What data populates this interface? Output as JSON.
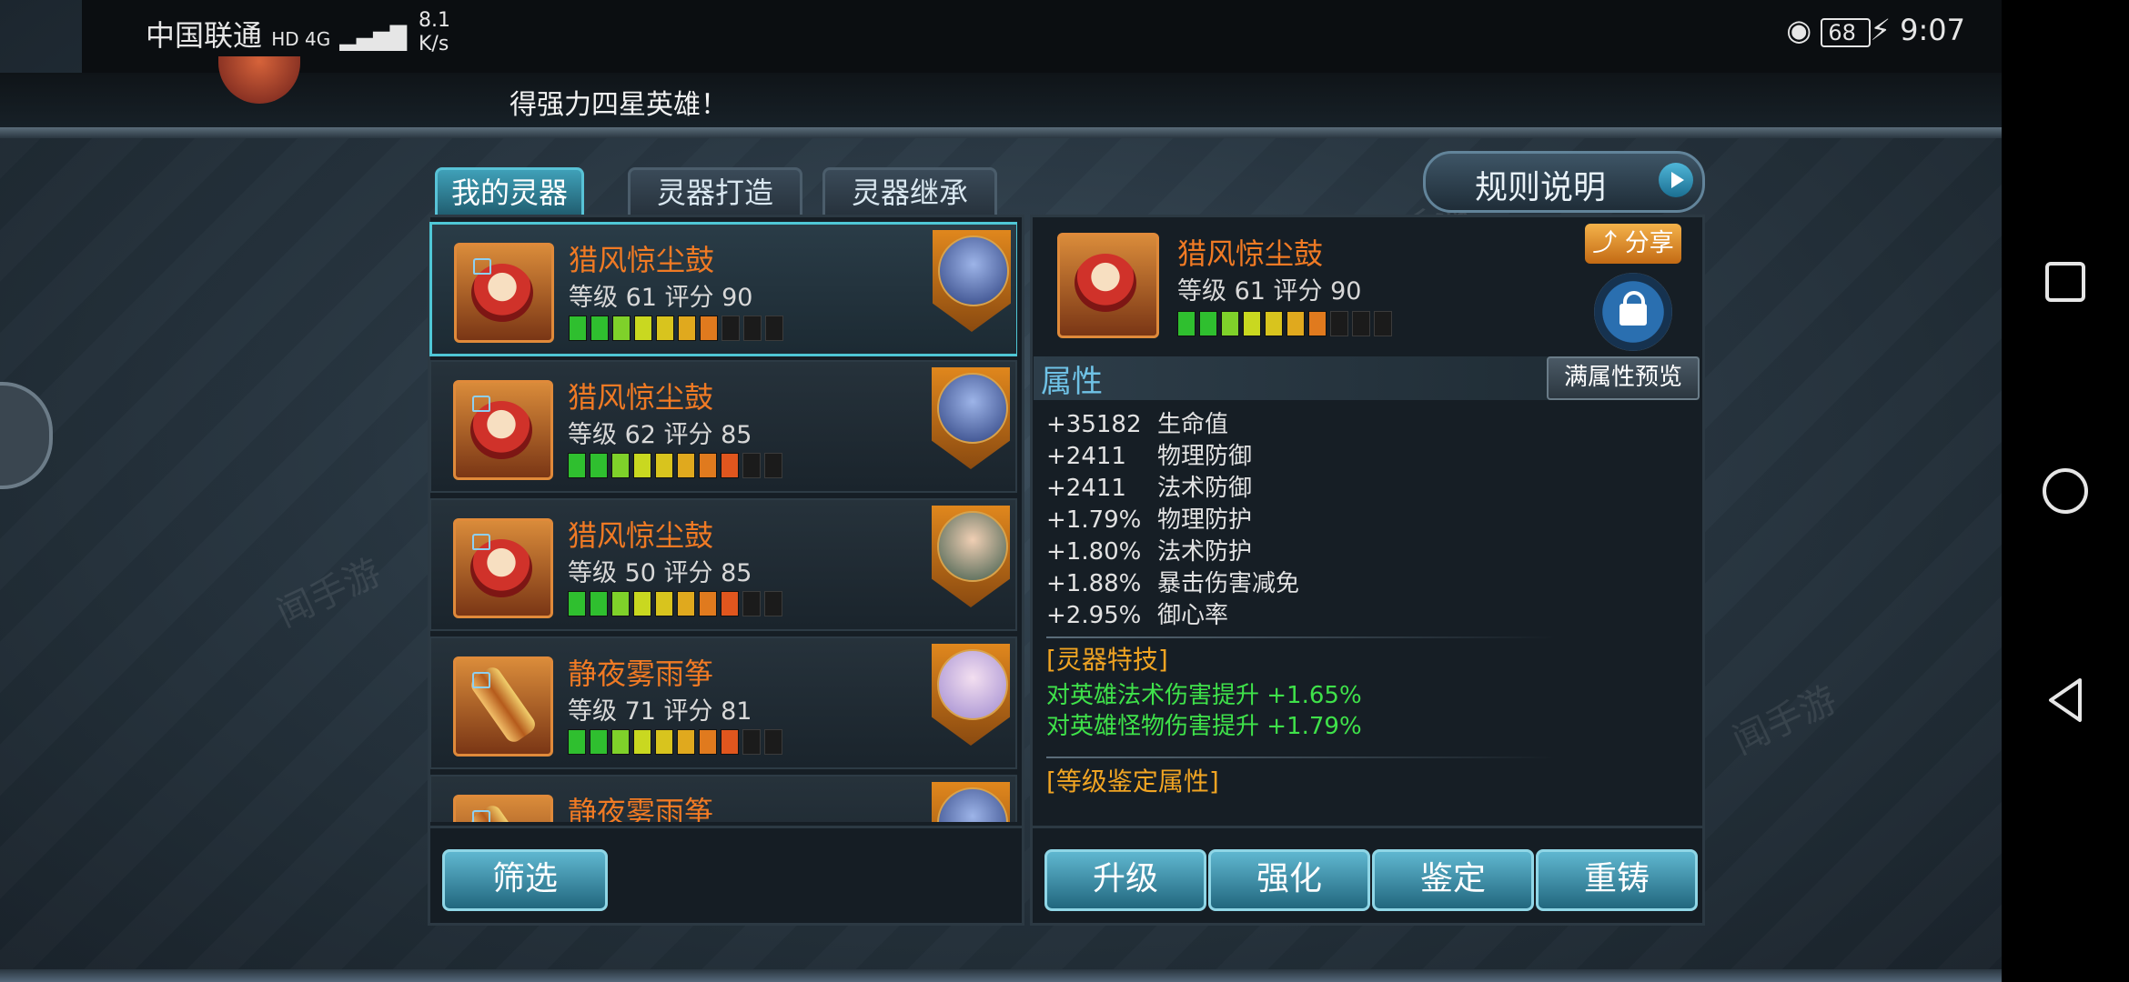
{
  "status_bar": {
    "carrier": "中国联通",
    "network": "HD 4G",
    "speed_value": "8.1",
    "speed_unit": "K/s",
    "battery": "68",
    "time": "9:07"
  },
  "marquee": {
    "text": "得强力四星英雄！"
  },
  "tabs": [
    {
      "label": "我的灵器",
      "active": true
    },
    {
      "label": "灵器打造",
      "active": false
    },
    {
      "label": "灵器继承",
      "active": false
    }
  ],
  "rules_button": "规则说明",
  "items": [
    {
      "name": "猎风惊尘鼓",
      "stats": "等级 61   评分 90",
      "icon": "drum-icon",
      "bars_lit": 7,
      "hero": "hero-avatar-blue"
    },
    {
      "name": "猎风惊尘鼓",
      "stats": "等级 62   评分 85",
      "icon": "drum-icon",
      "bars_lit": 8,
      "hero": "hero-avatar-blue"
    },
    {
      "name": "猎风惊尘鼓",
      "stats": "等级 50   评分 85",
      "icon": "drum-icon",
      "bars_lit": 8,
      "hero": "hero-avatar-swordsman"
    },
    {
      "name": "静夜雾雨筝",
      "stats": "等级 71   评分 81",
      "icon": "zither-icon",
      "bars_lit": 8,
      "hero": "hero-avatar-lady"
    },
    {
      "name": "静夜雾雨筝",
      "stats": "",
      "icon": "zither-icon",
      "bars_lit": 0,
      "hero": "hero-avatar"
    }
  ],
  "detail": {
    "name": "猎风惊尘鼓",
    "stats": "等级 61   评分 90",
    "bars_lit": 7,
    "share_label": "分享",
    "attributes_title": "属性",
    "preview_button": "满属性预览",
    "attributes": [
      {
        "value": "+35182",
        "label": "生命值"
      },
      {
        "value": "+2411",
        "label": "物理防御"
      },
      {
        "value": "+2411",
        "label": "法术防御"
      },
      {
        "value": "+1.79%",
        "label": "物理防护"
      },
      {
        "value": "+1.80%",
        "label": "法术防护"
      },
      {
        "value": "+1.88%",
        "label": "暴击伤害减免"
      },
      {
        "value": "+2.95%",
        "label": "御心率"
      }
    ],
    "special_title": "[灵器特技]",
    "special_lines": [
      "对英雄法术伤害提升 +1.65%",
      "对英雄怪物伤害提升 +1.79%"
    ],
    "level_title": "[等级鉴定属性]"
  },
  "filter_button": "筛选",
  "actions": [
    "升级",
    "强化",
    "鉴定",
    "重铸"
  ],
  "watermark": "闻手游",
  "colors": {
    "name_orange": "#f07a24",
    "accent_cyan": "#4fc7d6",
    "special_green": "#3fe24a",
    "section_gold": "#f0a423"
  }
}
